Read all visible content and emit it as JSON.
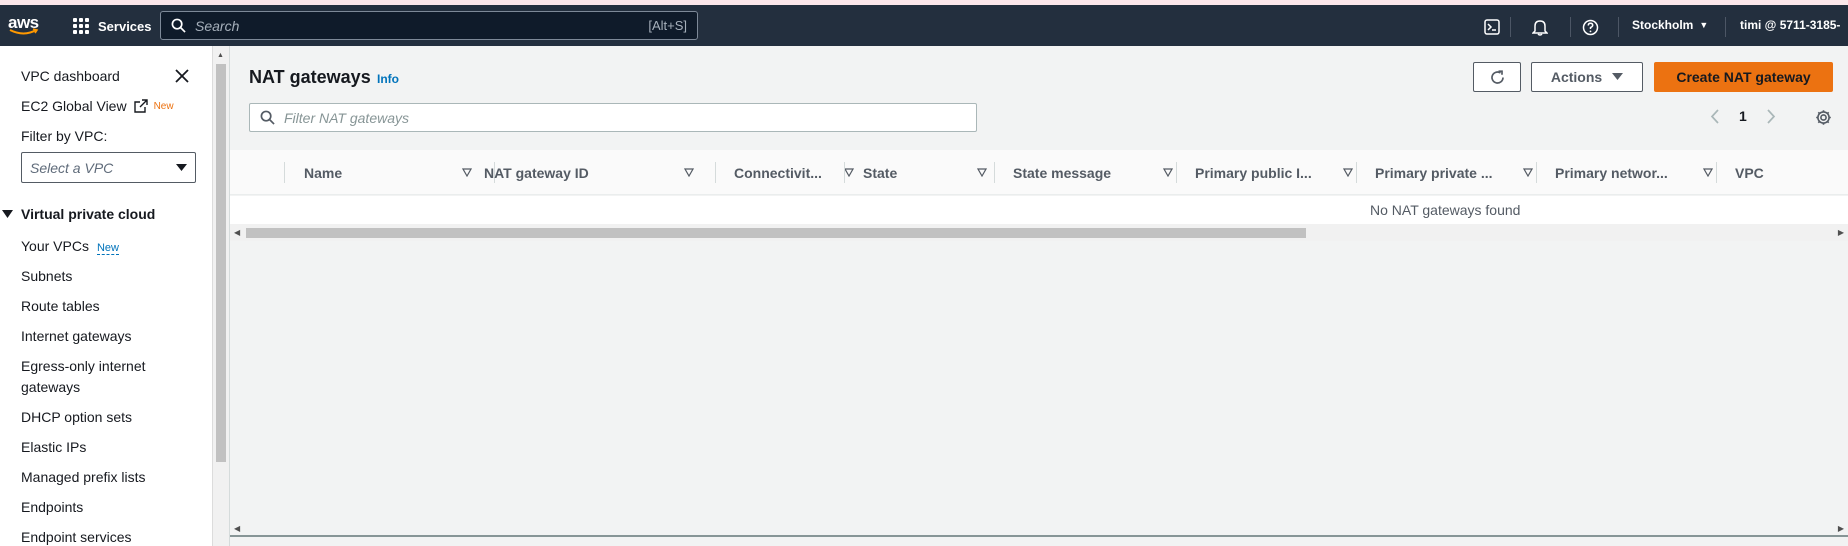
{
  "nav": {
    "logo_text": "aws",
    "services_label": "Services",
    "search_placeholder": "Search",
    "search_shortcut": "[Alt+S]",
    "region": "Stockholm",
    "account": "timi @ 5711-3185-"
  },
  "sidebar": {
    "dashboard": "VPC dashboard",
    "ec2_global_view": "EC2 Global View",
    "new_badge": "New",
    "filter_label": "Filter by VPC:",
    "vpc_select_placeholder": "Select a VPC",
    "section_title": "Virtual private cloud",
    "items": [
      {
        "label": "Your VPCs",
        "badge": "New"
      },
      {
        "label": "Subnets"
      },
      {
        "label": "Route tables"
      },
      {
        "label": "Internet gateways"
      },
      {
        "label": "Egress-only internet"
      },
      {
        "label": "gateways"
      },
      {
        "label": "DHCP option sets"
      },
      {
        "label": "Elastic IPs"
      },
      {
        "label": "Managed prefix lists"
      },
      {
        "label": "Endpoints"
      },
      {
        "label": "Endpoint services"
      }
    ]
  },
  "main": {
    "title": "NAT gateways",
    "info_label": "Info",
    "actions_label": "Actions",
    "create_label": "Create NAT gateway",
    "filter_placeholder": "Filter NAT gateways",
    "page_number": "1",
    "columns": [
      "Name",
      "NAT gateway ID",
      "Connectivit...",
      "State",
      "State message",
      "Primary public I...",
      "Primary private ...",
      "Primary networ...",
      "VPC"
    ],
    "empty_message": "No NAT gateways found"
  },
  "colors": {
    "nav_bg": "#232f3e",
    "primary_button": "#ec7211",
    "link": "#0073bb",
    "new_badge": "#ec7211"
  }
}
